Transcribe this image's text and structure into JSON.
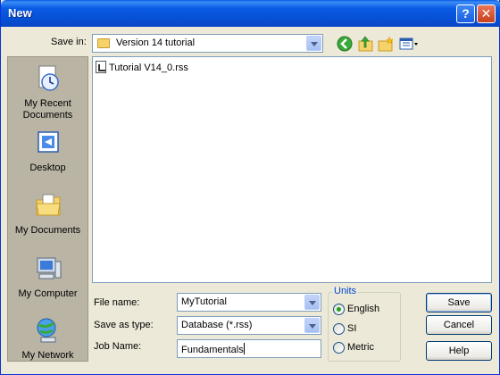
{
  "window": {
    "title": "New",
    "help_glyph": "?",
    "close_glyph": "✕"
  },
  "savein": {
    "label": "Save in:",
    "folder": "Version 14 tutorial",
    "toolbar_icons": [
      "back-icon",
      "up-folder-icon",
      "new-folder-icon",
      "views-menu-icon"
    ]
  },
  "places": [
    {
      "id": "recent",
      "label": "My Recent Documents",
      "icon": "recent-documents-icon"
    },
    {
      "id": "desktop",
      "label": "Desktop",
      "icon": "desktop-icon"
    },
    {
      "id": "documents",
      "label": "My Documents",
      "icon": "my-documents-icon"
    },
    {
      "id": "computer",
      "label": "My Computer",
      "icon": "my-computer-icon"
    },
    {
      "id": "network",
      "label": "My Network",
      "icon": "my-network-icon"
    }
  ],
  "files": [
    {
      "name": "Tutorial V14_0.rss",
      "icon": "rss-file-icon"
    }
  ],
  "form": {
    "filename_label": "File name:",
    "filename_value": "MyTutorial",
    "savetype_label": "Save as type:",
    "savetype_value": "Database (*.rss)",
    "jobname_label": "Job Name:",
    "jobname_value": "Fundamentals"
  },
  "units": {
    "legend": "Units",
    "options": [
      "English",
      "SI",
      "Metric"
    ],
    "selected": "English"
  },
  "buttons": {
    "save": "Save",
    "cancel": "Cancel",
    "help": "Help"
  }
}
